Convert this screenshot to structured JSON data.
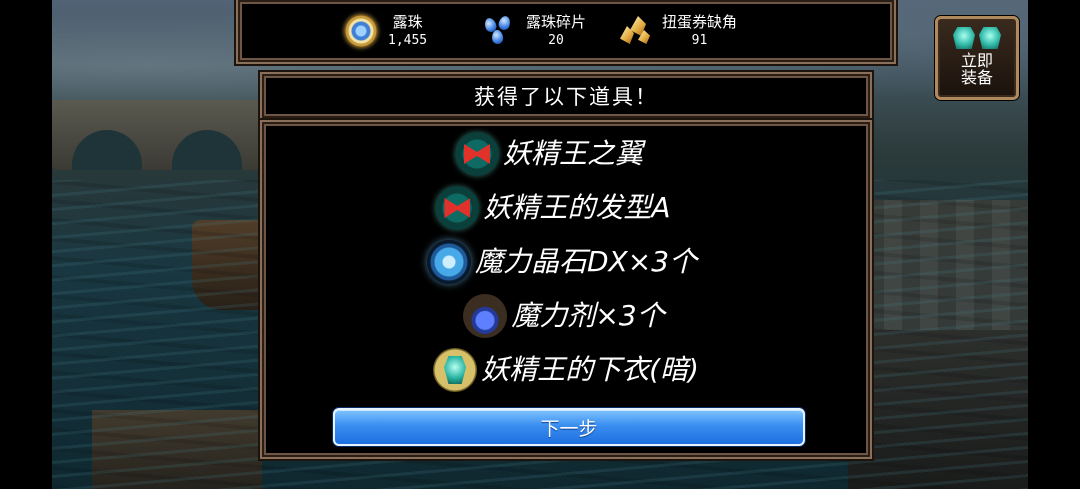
{
  "currencies": [
    {
      "name": "露珠",
      "value": "1,455",
      "icon": "dew-pearl-icon"
    },
    {
      "name": "露珠碎片",
      "value": "20",
      "icon": "dew-shard-icon"
    },
    {
      "name": "扭蛋券缺角",
      "value": "91",
      "icon": "gacha-ticket-fragment-icon"
    }
  ],
  "equip_button": {
    "label": "立即\n装备",
    "icon": "armor-icon"
  },
  "dialog": {
    "title": "获得了以下道具！",
    "items": [
      {
        "name": "妖精王之翼",
        "icon": "ribbon-icon"
      },
      {
        "name": "妖精王的发型A",
        "icon": "ribbon-icon"
      },
      {
        "name": "魔力晶石DX×3个",
        "icon": "crystal-gem-icon"
      },
      {
        "name": "魔力剂×3个",
        "icon": "potion-icon"
      },
      {
        "name": "妖精王的下衣(暗)",
        "icon": "armor-icon"
      }
    ],
    "next_label": "下一步"
  },
  "colors": {
    "frame": "#8a6f5a",
    "button_blue": "#3a8ef0",
    "panel": "#000000"
  }
}
